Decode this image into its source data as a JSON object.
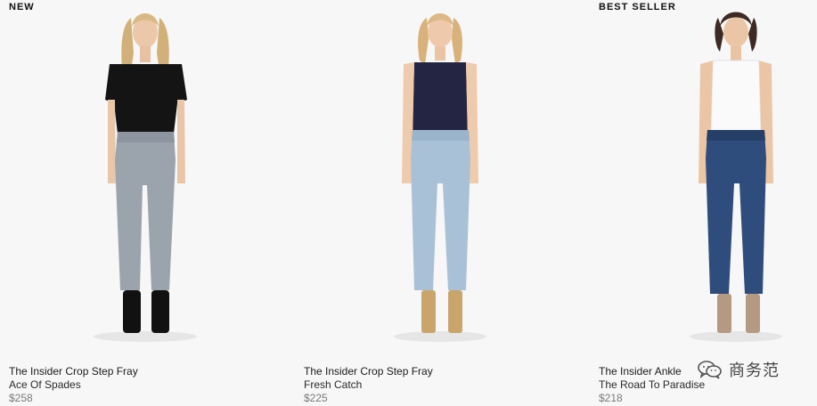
{
  "products": [
    {
      "badge": "NEW",
      "name": "The Insider Crop Step Fray",
      "variant": "Ace Of Spades",
      "price": "$258"
    },
    {
      "badge": "",
      "name": "The Insider Crop Step Fray",
      "variant": "Fresh Catch",
      "price": "$225"
    },
    {
      "badge": "BEST SELLER",
      "name": "The Insider Ankle",
      "variant": "The Road To Paradise",
      "price": "$218"
    }
  ],
  "watermark": {
    "text": "商务范",
    "icon": "wechat-icon"
  },
  "colors": {
    "background": "#f7f7f7",
    "price_text": "#7a7a7a"
  }
}
